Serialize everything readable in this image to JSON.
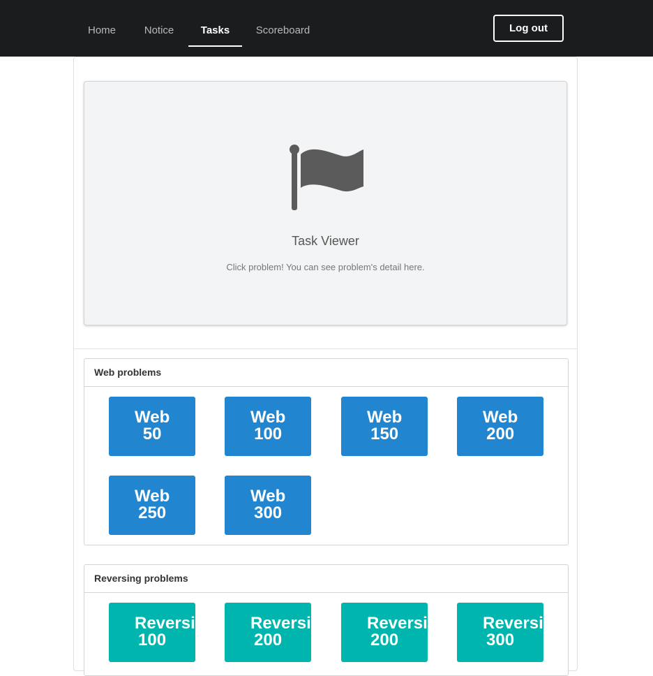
{
  "nav": {
    "items": [
      {
        "label": "Home",
        "active": false
      },
      {
        "label": "Notice",
        "active": false
      },
      {
        "label": "Tasks",
        "active": true
      },
      {
        "label": "Scoreboard",
        "active": false
      }
    ],
    "logout_label": "Log out"
  },
  "viewer": {
    "icon": "flag-icon",
    "title": "Task Viewer",
    "description": "Click problem! You can see problem's detail here."
  },
  "sections": [
    {
      "title": "Web problems",
      "color": "#2185d0",
      "problems": [
        {
          "category": "Web",
          "points": "50"
        },
        {
          "category": "Web",
          "points": "100"
        },
        {
          "category": "Web",
          "points": "150"
        },
        {
          "category": "Web",
          "points": "200"
        },
        {
          "category": "Web",
          "points": "250"
        },
        {
          "category": "Web",
          "points": "300"
        }
      ]
    },
    {
      "title": "Reversing problems",
      "color": "#00b5ad",
      "problems": [
        {
          "category": "Reversing",
          "points": "100"
        },
        {
          "category": "Reversing",
          "points": "200"
        },
        {
          "category": "Reversing",
          "points": "200"
        },
        {
          "category": "Reversing",
          "points": "300"
        }
      ]
    }
  ]
}
